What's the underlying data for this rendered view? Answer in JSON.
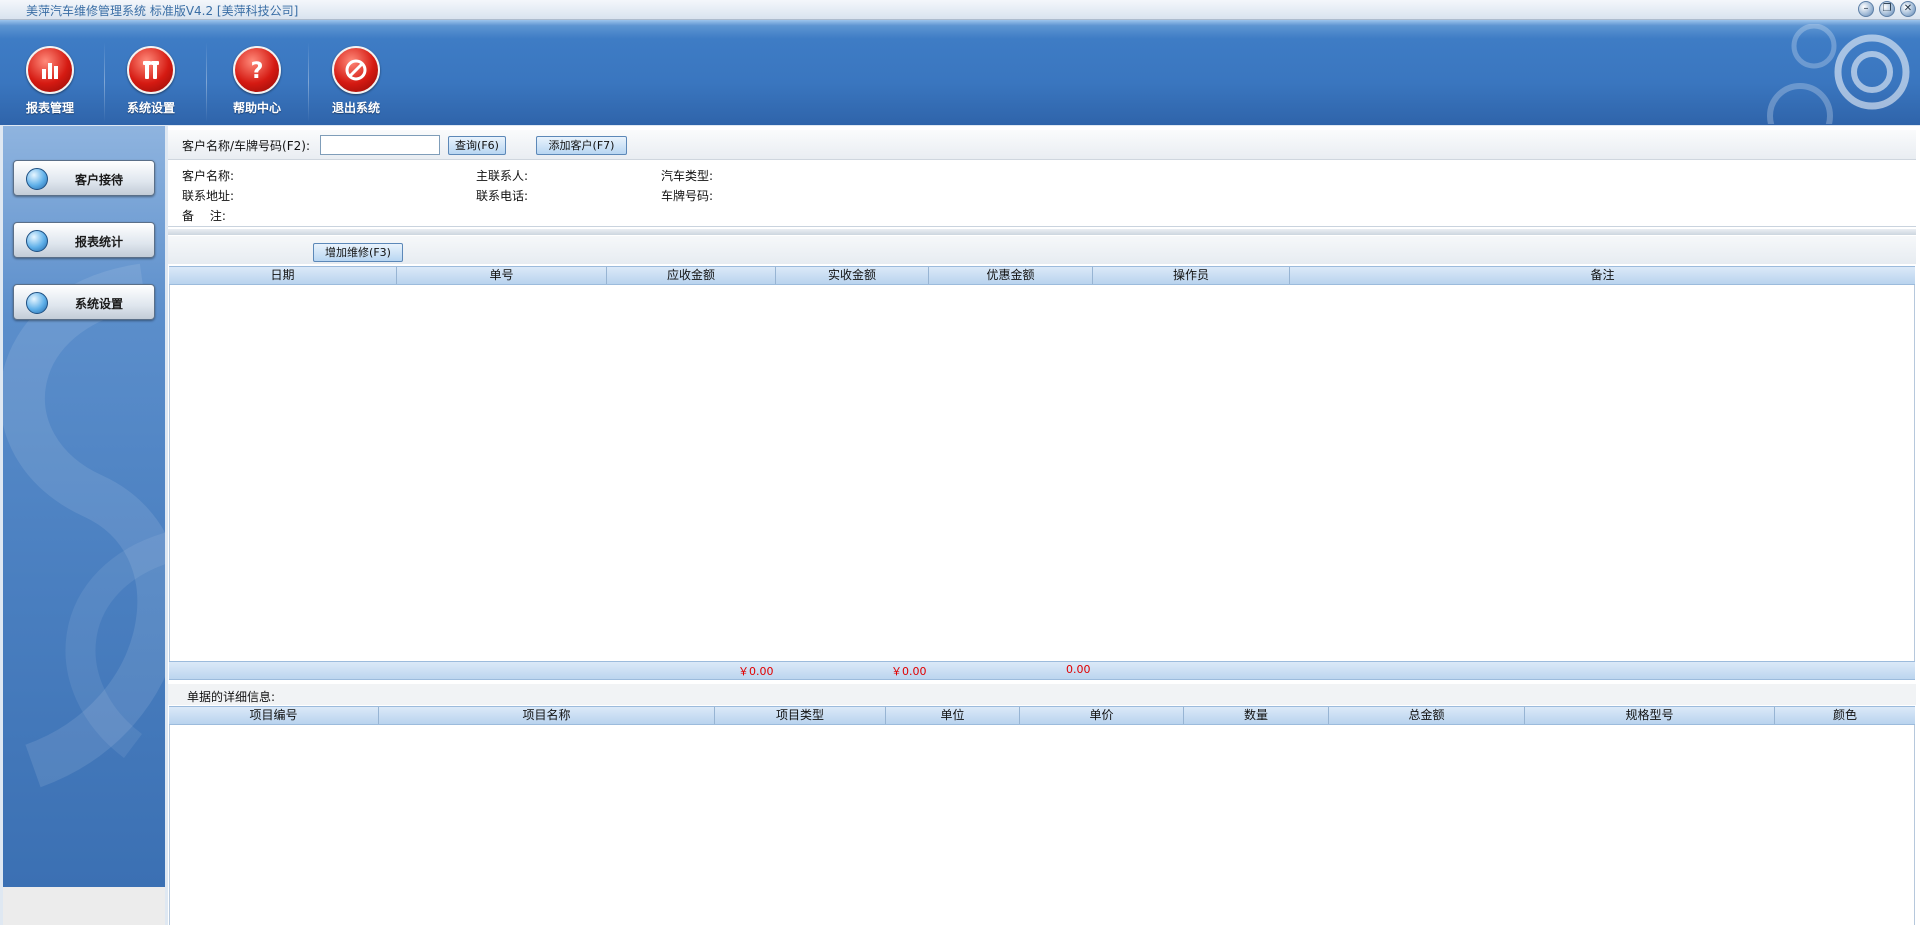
{
  "window": {
    "title": "美萍汽车维修管理系统 标准版V4.2 [美萍科技公司]",
    "controls": [
      "minimize",
      "restore",
      "close"
    ]
  },
  "toolbar": {
    "items": [
      {
        "label": "报表管理",
        "icon": "bar-chart-icon"
      },
      {
        "label": "系统设置",
        "icon": "tools-icon"
      },
      {
        "label": "帮助中心",
        "icon": "help-icon"
      },
      {
        "label": "退出系统",
        "icon": "exit-icon"
      }
    ]
  },
  "sidebar": {
    "items": [
      {
        "label": "客户接待"
      },
      {
        "label": "报表统计"
      },
      {
        "label": "系统设置"
      }
    ]
  },
  "search": {
    "label": "客户名称/车牌号码(F2):",
    "value": "",
    "query_button": "查询(F6)",
    "add_customer_button": "添加客户(F7)"
  },
  "customer_info": {
    "name_label": "客户名称:",
    "address_label": "联系地址:",
    "remark_label": "备　 注:",
    "contact_label": "主联系人:",
    "phone_label": "联系电话:",
    "car_type_label": "汽车类型:",
    "plate_label": "车牌号码:"
  },
  "repair": {
    "add_button": "增加维修(F3)",
    "columns": [
      "日期",
      "单号",
      "应收金额",
      "实收金额",
      "优惠金额",
      "操作员",
      "备注"
    ],
    "rows": [],
    "totals": {
      "receivable": "￥0.00",
      "received": "￥0.00",
      "discount": "0.00"
    }
  },
  "detail": {
    "label": "单据的详细信息:",
    "columns": [
      "项目编号",
      "项目名称",
      "项目类型",
      "单位",
      "单价",
      "数量",
      "总金额",
      "规格型号",
      "颜色"
    ],
    "rows": []
  },
  "colors": {
    "banner_blue": "#3a76bf",
    "header_blue": "#b9d3ee",
    "total_red": "#e00000",
    "icon_red": "#d51a12"
  }
}
